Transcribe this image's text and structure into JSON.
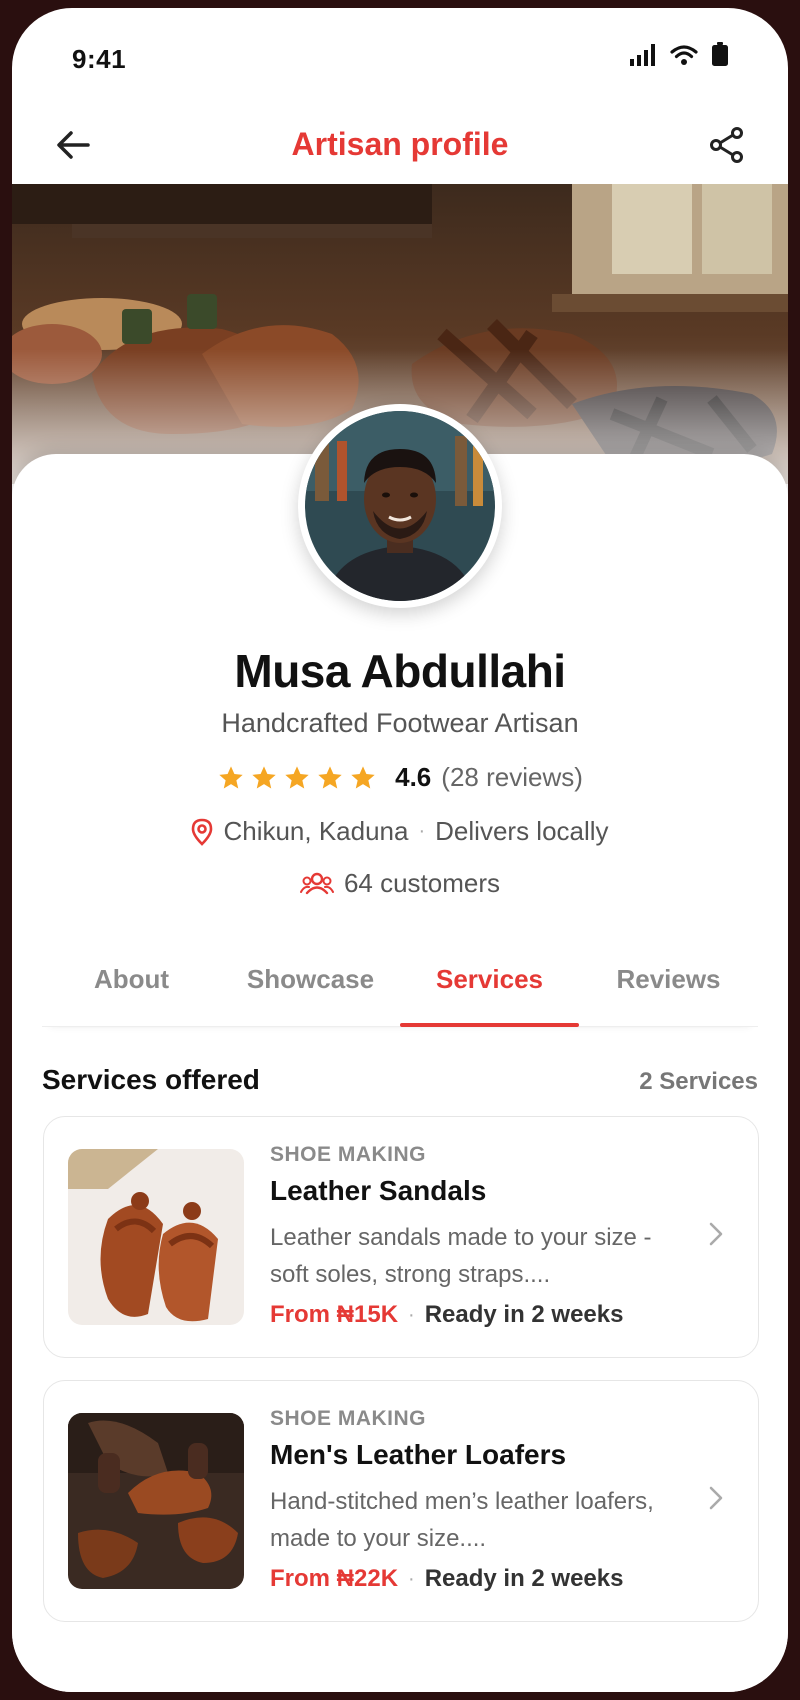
{
  "status": {
    "time": "9:41"
  },
  "appbar": {
    "title": "Artisan profile"
  },
  "profile": {
    "name": "Musa Abdullahi",
    "subtitle": "Handcrafted Footwear Artisan",
    "rating": "4.6",
    "stars": 5,
    "reviews": "(28 reviews)",
    "location": "Chikun, Kaduna",
    "delivery": "Delivers locally",
    "customers": "64 customers"
  },
  "tabs": [
    {
      "label": "About"
    },
    {
      "label": "Showcase"
    },
    {
      "label": "Services",
      "active": true
    },
    {
      "label": "Reviews"
    }
  ],
  "services": {
    "title": "Services offered",
    "count": "2 Services",
    "items": [
      {
        "category": "SHOE MAKING",
        "title": "Leather Sandals",
        "description": "Leather sandals made to your size - soft soles, strong straps....",
        "price": "From ₦15K",
        "ready": "Ready in 2 weeks"
      },
      {
        "category": "SHOE MAKING",
        "title": "Men's Leather Loafers",
        "description": "Hand-stitched men’s leather loafers, made to your size....",
        "price": "From ₦22K",
        "ready": "Ready in 2 weeks"
      }
    ]
  },
  "colors": {
    "accent": "#e53935",
    "star": "#f5a623"
  }
}
